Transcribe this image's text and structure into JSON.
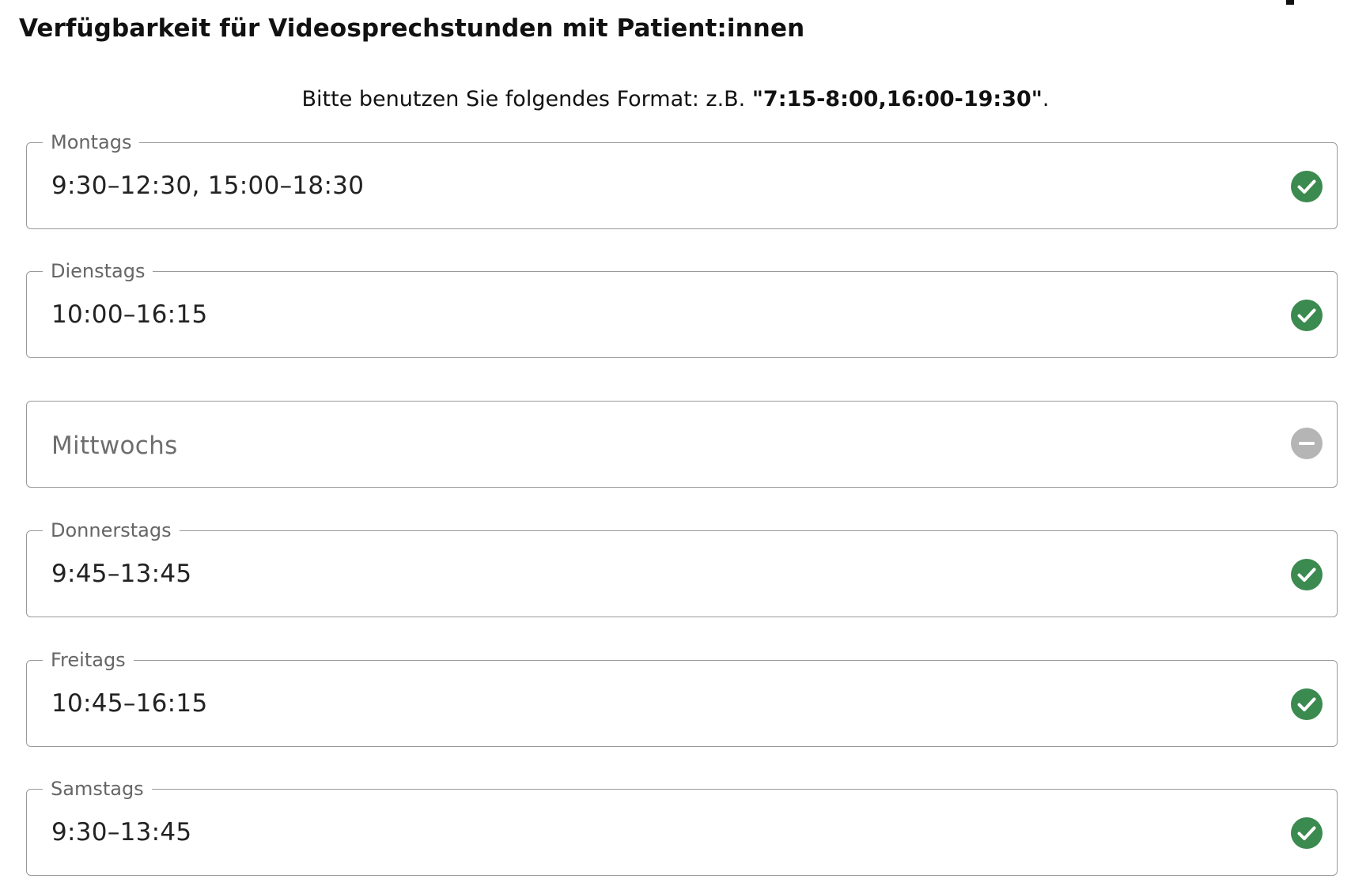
{
  "header": {
    "title": "Verfügbarkeit für Videosprechstunden mit Patient:innen"
  },
  "hint": {
    "prefix": "Bitte benutzen Sie folgendes Format: z.B. ",
    "example": "\"7:15-8:00,16:00-19:30\"",
    "suffix": "."
  },
  "colors": {
    "valid": "#3b8a4f",
    "empty": "#b5b5b5",
    "border": "#9a9a9a",
    "label": "#666666"
  },
  "days": [
    {
      "label": "Montags",
      "value": "9:30–12:30, 15:00–18:30",
      "status": "valid",
      "icon": "check-circle-icon"
    },
    {
      "label": "Dienstags",
      "value": "10:00–16:15",
      "status": "valid",
      "icon": "check-circle-icon"
    },
    {
      "label": "Mittwochs",
      "value": "",
      "status": "empty",
      "icon": "minus-circle-icon"
    },
    {
      "label": "Donnerstags",
      "value": "9:45–13:45",
      "status": "valid",
      "icon": "check-circle-icon"
    },
    {
      "label": "Freitags",
      "value": "10:45–16:15",
      "status": "valid",
      "icon": "check-circle-icon"
    },
    {
      "label": "Samstags",
      "value": "9:30–13:45",
      "status": "valid",
      "icon": "check-circle-icon"
    }
  ]
}
